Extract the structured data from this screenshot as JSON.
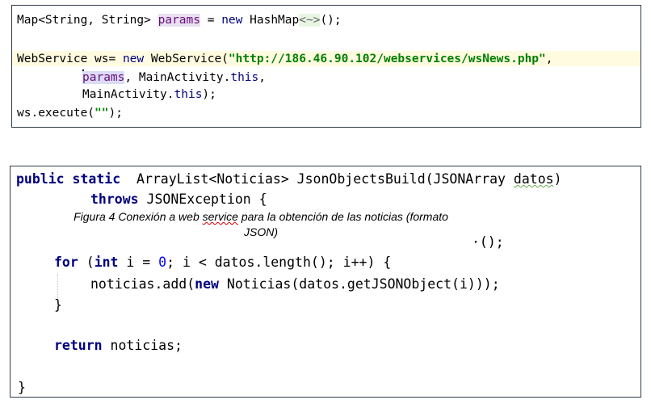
{
  "code_top": {
    "line1": {
      "a": "Map<String, String> ",
      "params": "params",
      "b": " = ",
      "new": "new",
      "c": " HashMap",
      "diamond": "<~>",
      "d": "();"
    },
    "line2": {
      "a": "WebService ws= ",
      "new": "new",
      "b": " WebService(",
      "url": "\"http://186.46.90.102/webservices/wsNews.php\"",
      "c": ","
    },
    "line3": {
      "params": "params",
      "a": ", MainActivity.",
      "this": "this",
      "b": ","
    },
    "line4": {
      "a": "MainActivity.",
      "this": "this",
      "b": ");"
    },
    "line5": {
      "a": "ws.execute(",
      "str": "\"\"",
      "b": ");"
    }
  },
  "code_bottom": {
    "line1": {
      "kw": "public static",
      "a": "  ArrayList<Noticias> JsonObjectsBuild(JSONArray ",
      "datos": "datos",
      "b": ")"
    },
    "line2": {
      "kw": "throws",
      "a": " JSONException {"
    },
    "line3_tail": "·();",
    "line4": {
      "for": "for",
      "a": " (",
      "int": "int",
      "b": " i = ",
      "zero": "0",
      "c": "; i < datos.length(); i++) {"
    },
    "line5": {
      "a": "noticias.add(",
      "new": "new",
      "b": " Noticias(datos.getJSONObject(i)));"
    },
    "line6": "}",
    "line7": {
      "return": "return",
      "a": " noticias;"
    },
    "line8": "}"
  },
  "caption": {
    "part1": "Figura 4 Conexión a web ",
    "service": "service",
    "part2": " para la obtención de las noticias (formato",
    "line2": "JSON)"
  }
}
